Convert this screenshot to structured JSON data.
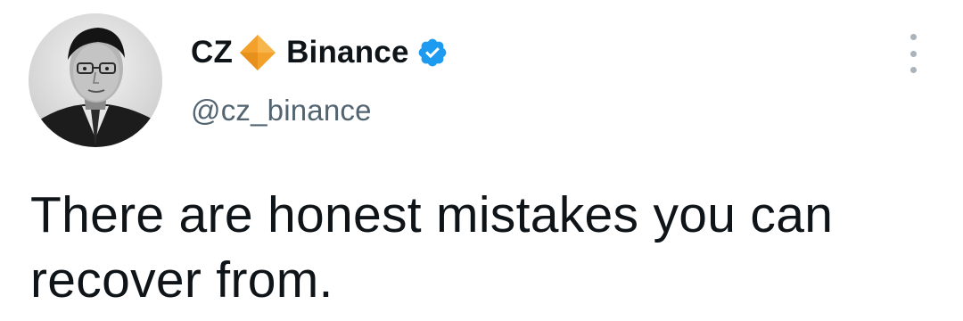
{
  "author": {
    "display_name_first": "CZ",
    "display_name_second": "Binance",
    "handle": "@cz_binance"
  },
  "tweet": {
    "text_line1": "There are honest mistakes you can",
    "text_line2": "recover from."
  },
  "icons": {
    "diamond": "diamond-icon",
    "verified": "verified-badge-icon",
    "more": "more-options-icon"
  },
  "colors": {
    "text": "#0f1419",
    "handle": "#536471",
    "verified": "#1d9bf0",
    "diamond": "#f0b90b"
  }
}
